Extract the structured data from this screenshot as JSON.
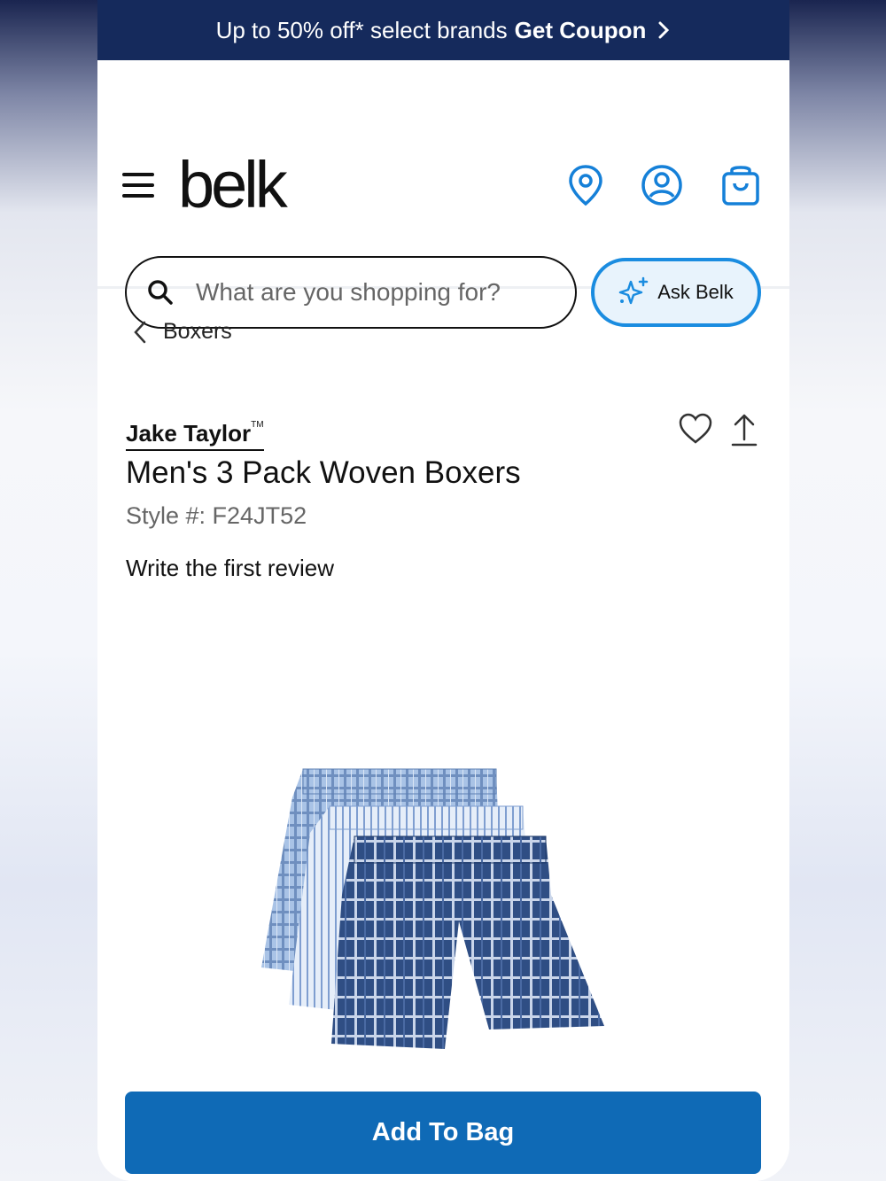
{
  "promo": {
    "text": "Up to 50% off* select brands",
    "link": "Get Coupon"
  },
  "header": {
    "logo": "belk"
  },
  "search": {
    "placeholder": "What are you shopping for?"
  },
  "ask": {
    "label": "Ask Belk"
  },
  "breadcrumb": {
    "label": "Boxers"
  },
  "product": {
    "brand": "Jake Taylor",
    "brand_mark": "TM",
    "title": "Men's 3 Pack Woven Boxers",
    "style": "Style #: F24JT52",
    "review_link": "Write the first review"
  },
  "cta": {
    "add_to_bag": "Add To Bag"
  },
  "colors": {
    "promo_bg": "#152a5c",
    "accent": "#1a8ce0",
    "button": "#0f6ab6"
  }
}
